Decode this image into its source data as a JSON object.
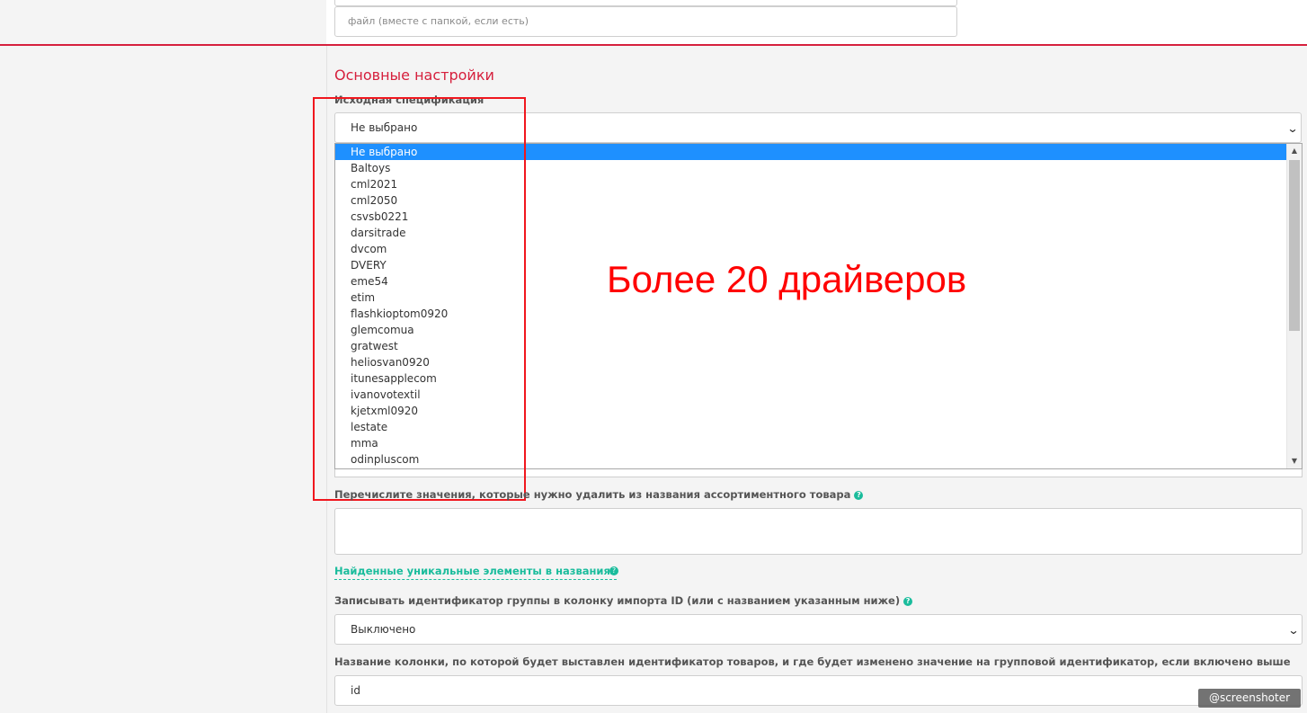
{
  "file_input": {
    "placeholder": "файл (вместе с папкой, если есть)"
  },
  "section_title": "Основные настройки",
  "source_spec": {
    "label": "Исходная спецификация",
    "selected": "Не выбрано",
    "options": [
      "Не выбрано",
      "Baltoys",
      "cml2021",
      "cml2050",
      "csvsb0221",
      "darsitrade",
      "dvcom",
      "DVERY",
      "eme54",
      "etim",
      "flashkioptom0920",
      "glemcomua",
      "gratwest",
      "heliosvan0920",
      "itunesapplecom",
      "ivanovotextil",
      "kjetxml0920",
      "lestate",
      "mma",
      "odinpluscom"
    ]
  },
  "annotation": "Более 20 драйверов",
  "remove_values": {
    "label": "Перечислите значения, которые нужно удалить из названия ассортиментного товара",
    "value": ""
  },
  "found_link": "Найденные уникальные элементы в названиях",
  "group_id": {
    "label": "Записывать идентификатор группы в колонку импорта ID (или с названием указанным ниже)",
    "value": "Выключено"
  },
  "column_name": {
    "label": "Название колонки, по которой будет выставлен идентификатор товаров, и где будет изменено значение на групповой идентификатор, если включено выше",
    "value": "id"
  },
  "help_icon": "?",
  "watermark": "@screenshoter",
  "colors": {
    "accent_red": "#d6203d",
    "link_green": "#1abc9c",
    "selection_blue": "#1e90ff",
    "annotation_red": "#ff0000"
  }
}
